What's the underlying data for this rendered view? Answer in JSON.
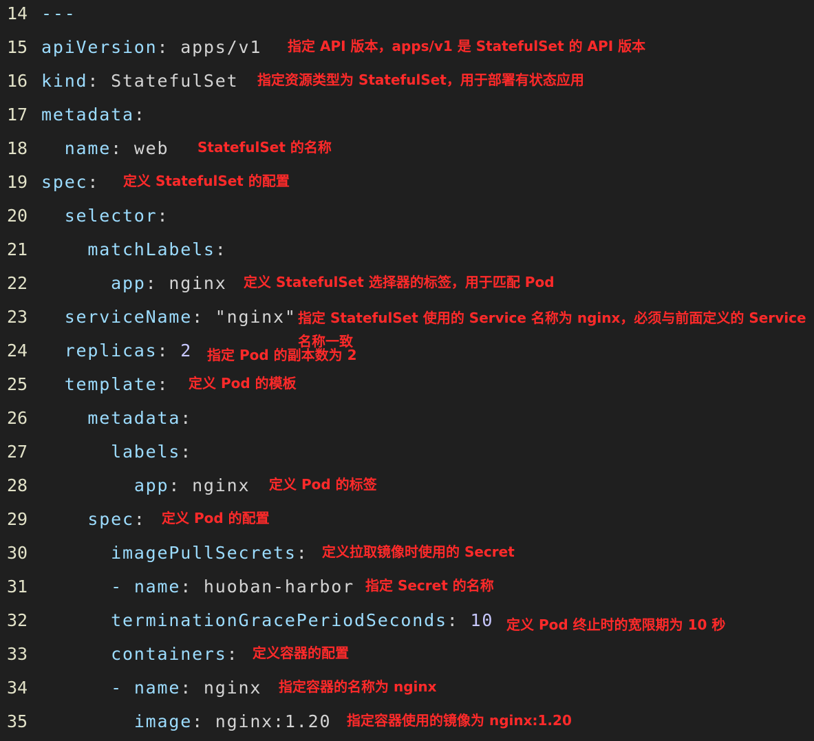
{
  "colors": {
    "background": "#1f1f1f",
    "line_number": "#e2e2c8",
    "key": "#9cdcfe",
    "value": "#d4d4d4",
    "number": "#c8c8ff",
    "annotation": "#ff2a2a"
  },
  "lines": [
    {
      "num": "14",
      "indent": "",
      "dash": "",
      "key": "---",
      "colon": "",
      "value": "",
      "note": ""
    },
    {
      "num": "15",
      "indent": "",
      "dash": "",
      "key": "apiVersion",
      "colon": ": ",
      "value": "apps/v1",
      "note": "指定 API 版本，apps/v1 是 StatefulSet 的 API 版本"
    },
    {
      "num": "16",
      "indent": "",
      "dash": "",
      "key": "kind",
      "colon": ": ",
      "value": "StatefulSet",
      "note": "指定资源类型为 StatefulSet，用于部署有状态应用"
    },
    {
      "num": "17",
      "indent": "",
      "dash": "",
      "key": "metadata",
      "colon": ":",
      "value": "",
      "note": ""
    },
    {
      "num": "18",
      "indent": "  ",
      "dash": "",
      "key": "name",
      "colon": ": ",
      "value": "web",
      "note": "StatefulSet 的名称"
    },
    {
      "num": "19",
      "indent": "",
      "dash": "",
      "key": "spec",
      "colon": ":",
      "value": "",
      "note": "定义 StatefulSet 的配置"
    },
    {
      "num": "20",
      "indent": "  ",
      "dash": "",
      "key": "selector",
      "colon": ":",
      "value": "",
      "note": ""
    },
    {
      "num": "21",
      "indent": "    ",
      "dash": "",
      "key": "matchLabels",
      "colon": ":",
      "value": "",
      "note": ""
    },
    {
      "num": "22",
      "indent": "      ",
      "dash": "",
      "key": "app",
      "colon": ": ",
      "value": "nginx",
      "note": "定义 StatefulSet 选择器的标签，用于匹配 Pod"
    },
    {
      "num": "23",
      "indent": "  ",
      "dash": "",
      "key": "serviceName",
      "colon": ": ",
      "value": "\"nginx\"",
      "note": "指定 StatefulSet 使用的 Service 名称为 nginx，必须与前面定义的 Service 名称一致"
    },
    {
      "num": "24",
      "indent": "  ",
      "dash": "",
      "key": "replicas",
      "colon": ": ",
      "value": "2",
      "note": "指定 Pod 的副本数为 2"
    },
    {
      "num": "25",
      "indent": "  ",
      "dash": "",
      "key": "template",
      "colon": ":",
      "value": "",
      "note": "定义 Pod 的模板"
    },
    {
      "num": "26",
      "indent": "    ",
      "dash": "",
      "key": "metadata",
      "colon": ":",
      "value": "",
      "note": ""
    },
    {
      "num": "27",
      "indent": "      ",
      "dash": "",
      "key": "labels",
      "colon": ":",
      "value": "",
      "note": ""
    },
    {
      "num": "28",
      "indent": "        ",
      "dash": "",
      "key": "app",
      "colon": ": ",
      "value": "nginx",
      "note": "定义 Pod 的标签"
    },
    {
      "num": "29",
      "indent": "    ",
      "dash": "",
      "key": "spec",
      "colon": ":",
      "value": "",
      "note": "定义 Pod 的配置"
    },
    {
      "num": "30",
      "indent": "      ",
      "dash": "",
      "key": "imagePullSecrets",
      "colon": ":",
      "value": "",
      "note": "定义拉取镜像时使用的 Secret"
    },
    {
      "num": "31",
      "indent": "      ",
      "dash": "- ",
      "key": "name",
      "colon": ": ",
      "value": "huoban-harbor",
      "note": "指定 Secret 的名称"
    },
    {
      "num": "32",
      "indent": "      ",
      "dash": "",
      "key": "terminationGracePeriodSeconds",
      "colon": ": ",
      "value": "10",
      "note": "定义 Pod 终止时的宽限期为 10 秒"
    },
    {
      "num": "33",
      "indent": "      ",
      "dash": "",
      "key": "containers",
      "colon": ":",
      "value": "",
      "note": "定义容器的配置"
    },
    {
      "num": "34",
      "indent": "      ",
      "dash": "- ",
      "key": "name",
      "colon": ": ",
      "value": "nginx",
      "note": "指定容器的名称为 nginx"
    },
    {
      "num": "35",
      "indent": "        ",
      "dash": "",
      "key": "image",
      "colon": ": ",
      "value": "nginx:1.20",
      "note": "指定容器使用的镜像为 nginx:1.20"
    }
  ]
}
